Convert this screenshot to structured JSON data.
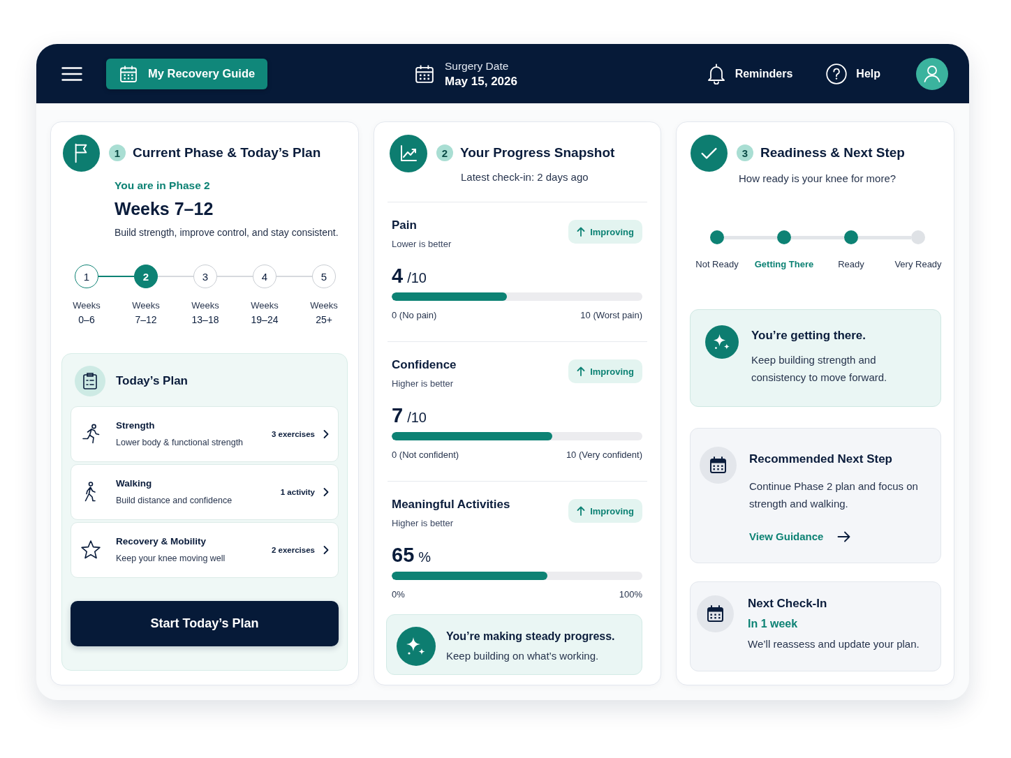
{
  "header": {
    "app_button": "My Recovery Guide",
    "surgery_date": {
      "label": "Surgery Date",
      "value": "May 15, 2026"
    },
    "reminders": "Reminders",
    "help": "Help"
  },
  "phase_card": {
    "number": "1",
    "title": "Current Phase & Today’s Plan",
    "phase_label": "You are in Phase 2",
    "weeks": "Weeks 7–12",
    "description": "Build strength, improve control, and stay consistent.",
    "steps": [
      {
        "number": "1",
        "label": "Weeks",
        "range": "0–6",
        "completed": true,
        "selected": false
      },
      {
        "number": "2",
        "label": "Weeks",
        "range": "7–12",
        "completed": false,
        "selected": true
      },
      {
        "number": "3",
        "label": "Weeks",
        "range": "13–18",
        "completed": false,
        "selected": false
      },
      {
        "number": "4",
        "label": "Weeks",
        "range": "19–24",
        "completed": false,
        "selected": false
      },
      {
        "number": "5",
        "label": "Weeks",
        "range": "25+",
        "completed": false,
        "selected": false
      }
    ],
    "todays_plan": {
      "title": "Today’s Plan",
      "items": [
        {
          "kind": "running",
          "title": "Strength",
          "subtitle": "Lower body & functional strength",
          "count": "3 exercises"
        },
        {
          "kind": "walking",
          "title": "Walking",
          "subtitle": "Build distance and confidence",
          "count": "1 activity"
        },
        {
          "kind": "star",
          "title": "Recovery & Mobility",
          "subtitle": "Keep your knee moving well",
          "count": "2 exercises"
        }
      ],
      "start_button": "Start Today’s Plan"
    }
  },
  "progress_card": {
    "number": "2",
    "title": "Your Progress Snapshot",
    "subtitle": "Latest check-in: 2 days ago",
    "metrics": [
      {
        "name": "Pain",
        "hint": "Lower is better",
        "trend": "Improving",
        "value": "4",
        "unit": "/10",
        "level": 0.46,
        "min_label": "0 (No pain)",
        "max_label": "10 (Worst pain)"
      },
      {
        "name": "Confidence",
        "hint": "Higher is better",
        "trend": "Improving",
        "value": "7",
        "unit": "/10",
        "level": 0.64,
        "min_label": "0 (Not confident)",
        "max_label": "10 (Very confident)"
      },
      {
        "name": "Meaningful Activities",
        "hint": "Higher is better",
        "trend": "Improving",
        "value": "65",
        "unit": "%",
        "level": 0.62,
        "min_label": "0%",
        "max_label": "100%"
      }
    ],
    "callout": {
      "title": "You’re making steady progress.",
      "text": "Keep building on what’s working."
    }
  },
  "readiness_card": {
    "number": "3",
    "title": "Readiness & Next Step",
    "subtitle": "How ready is your knee for more?",
    "scale": [
      {
        "label": "Not Ready",
        "filled": true,
        "selected": false
      },
      {
        "label": "Getting There",
        "filled": true,
        "selected": true
      },
      {
        "label": "Ready",
        "filled": true,
        "selected": false
      },
      {
        "label": "Very Ready",
        "filled": false,
        "selected": false
      }
    ],
    "status": {
      "title": "You’re getting there.",
      "text": "Keep building strength and consistency to move forward."
    },
    "next_step": {
      "title": "Recommended Next Step",
      "text": "Continue Phase 2 plan and focus on strength and walking.",
      "link": "View Guidance"
    },
    "check_in": {
      "title": "Next Check-In",
      "when": "In 1 week",
      "text": "We’ll reassess and update your plan."
    }
  }
}
